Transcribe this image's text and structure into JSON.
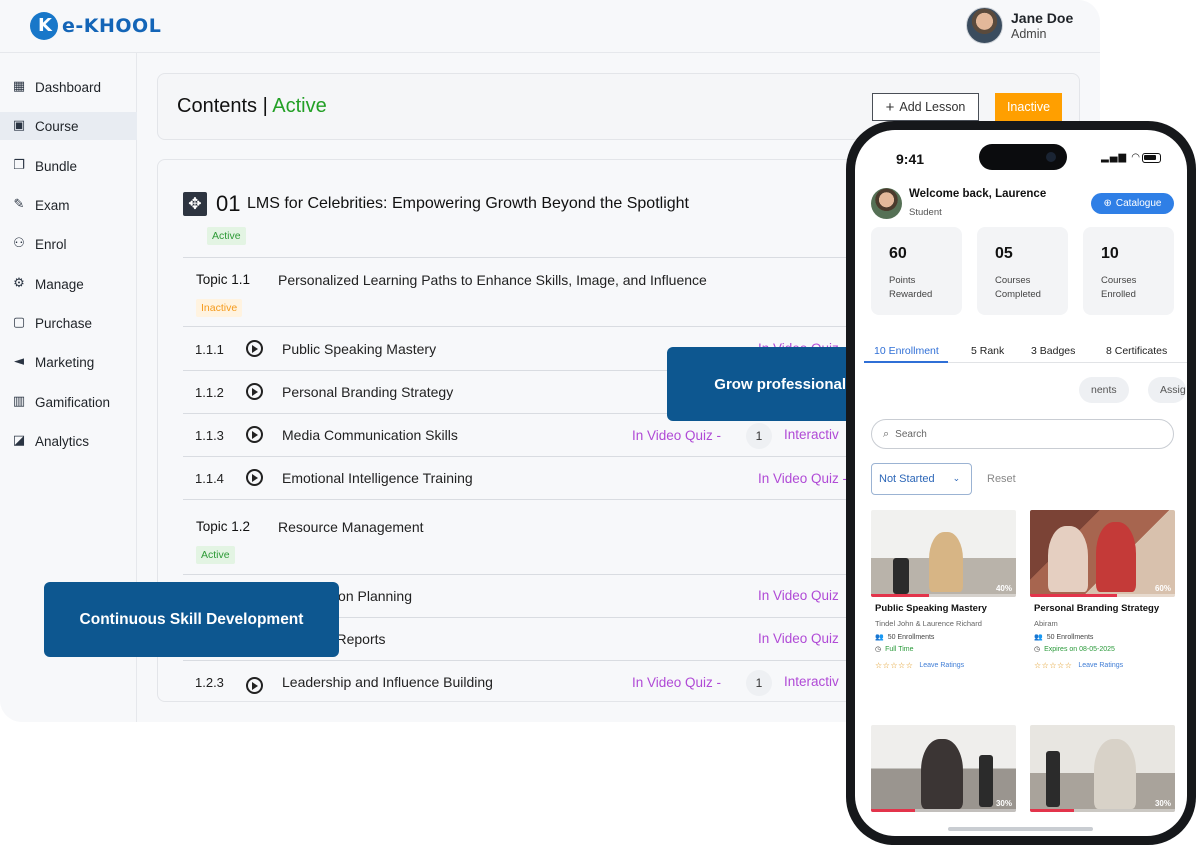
{
  "app": {
    "brand": "e-KHOOL",
    "user_name": "Jane Doe",
    "user_role": "Admin"
  },
  "sidebar": {
    "items": [
      {
        "label": "Dashboard",
        "icon": "dashboard-icon"
      },
      {
        "label": "Course",
        "icon": "course-icon",
        "active": true
      },
      {
        "label": "Bundle",
        "icon": "bundle-icon"
      },
      {
        "label": "Exam",
        "icon": "exam-icon"
      },
      {
        "label": "Enrol",
        "icon": "enrol-icon"
      },
      {
        "label": "Manage",
        "icon": "manage-icon"
      },
      {
        "label": "Purchase",
        "icon": "purchase-icon"
      },
      {
        "label": "Marketing",
        "icon": "marketing-icon"
      },
      {
        "label": "Gamification",
        "icon": "gamification-icon"
      },
      {
        "label": "Analytics",
        "icon": "analytics-icon"
      }
    ]
  },
  "header": {
    "title": "Contents |",
    "status": "Active",
    "add_lesson": "Add Lesson",
    "inactive_button": "Inactive"
  },
  "lesson": {
    "number": "01",
    "title": "LMS for Celebrities: Empowering Growth Beyond the Spotlight",
    "status": "Active",
    "topics": [
      {
        "label": "Topic 1.1",
        "title": "Personalized Learning Paths to Enhance Skills, Image, and Influence",
        "status": "Inactive",
        "rows": [
          {
            "num": "1.1.1",
            "title": "Public Speaking Mastery",
            "quiz": "In Video Quiz -"
          },
          {
            "num": "1.1.2",
            "title": "Personal Branding Strategy",
            "quiz": ""
          },
          {
            "num": "1.1.3",
            "title": "Media Communication Skills",
            "quiz": "In Video Quiz -",
            "quiz_count": "1",
            "interactive": "Interactiv"
          },
          {
            "num": "1.1.4",
            "title": "Emotional Intelligence Training",
            "quiz": "In Video Quiz -"
          }
        ]
      },
      {
        "label": "Topic 1.2",
        "title": "Resource Management",
        "status": "Active",
        "rows": [
          {
            "num": "",
            "title": "e Allocation Planning",
            "quiz": "In Video Quiz"
          },
          {
            "num": "",
            "title": "tilization Reports",
            "quiz": "In Video Quiz"
          },
          {
            "num": "1.2.3",
            "title": "Leadership and Influence Building",
            "quiz": "In Video Quiz -",
            "quiz_count": "1",
            "interactive": "Interactiv"
          }
        ]
      }
    ]
  },
  "callouts": {
    "top": "Grow professionalism via communication LMS",
    "bottom": "Continuous Skill Development"
  },
  "phone": {
    "time": "9:41",
    "welcome": "Welcome back, Laurence",
    "role": "Student",
    "catalogue": "Catalogue",
    "stats": [
      {
        "value": "60",
        "label": "Points Rewarded"
      },
      {
        "value": "05",
        "label": "Courses Completed"
      },
      {
        "value": "10",
        "label": "Courses Enrolled"
      }
    ],
    "tabs": [
      "10 Enrollment",
      "5 Rank",
      "3 Badges",
      "8 Certificates"
    ],
    "pills": [
      "nents",
      "Assig"
    ],
    "search_placeholder": "Search",
    "filter": "Not Started",
    "reset": "Reset",
    "courses": [
      {
        "title": "Public Speaking Mastery",
        "author": "Tindel John & Laurence Richard",
        "enrollments": "50 Enrollments",
        "access": "Full Time",
        "rating_link": "Leave Ratings",
        "progress_label": "40%",
        "progress": 0.4
      },
      {
        "title": "Personal Branding Strategy",
        "author": "Abiram",
        "enrollments": "50 Enrollments",
        "access": "Expires on 08-05-2025",
        "rating_link": "Leave Ratings",
        "progress_label": "60%",
        "progress": 0.6
      },
      {
        "progress_label": "30%",
        "progress": 0.3
      },
      {
        "progress_label": "30%",
        "progress": 0.3
      }
    ]
  },
  "colors": {
    "brand": "#1465b7",
    "active_green": "#23a026",
    "inactive_orange": "#ff9f00",
    "quiz_purple": "#b04ad6",
    "callout_blue": "#0d5790"
  }
}
